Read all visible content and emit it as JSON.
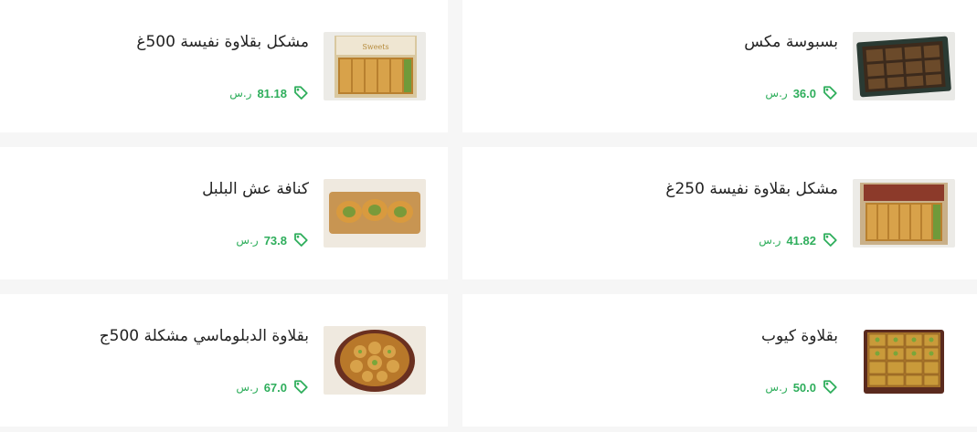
{
  "colors": {
    "price_green": "#2fae5c",
    "page_bg": "#f6f6f6",
    "card_bg": "#ffffff"
  },
  "products": [
    {
      "name": "بسبوسة مكس",
      "price": "36.0",
      "currency": "ر.س",
      "image_icon": "basbousa-box-image"
    },
    {
      "name": "مشكل بقلاوة نفيسة 500غ",
      "price": "81.18",
      "currency": "ر.س",
      "image_icon": "baklava-gift-box-image"
    },
    {
      "name": "مشكل بقلاوة نفيسة 250غ",
      "price": "41.82",
      "currency": "ر.س",
      "image_icon": "baklava-gift-box-small-image"
    },
    {
      "name": "كنافة عش البلبل",
      "price": "73.8",
      "currency": "ر.س",
      "image_icon": "kunafa-nest-image"
    },
    {
      "name": "بقلاوة كيوب",
      "price": "50.0",
      "currency": "ر.س",
      "image_icon": "baklava-cube-tray-image"
    },
    {
      "name": "بقلاوة الدبلوماسي مشكلة 500ج",
      "price": "67.0",
      "currency": "ر.س",
      "image_icon": "diplomat-baklava-tray-image"
    }
  ]
}
